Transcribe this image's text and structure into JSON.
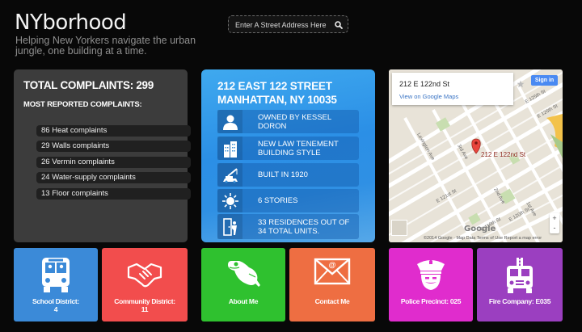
{
  "header": {
    "brand": "NYborhood",
    "tagline": "Helping New Yorkers navigate the urban jungle, one building at a time.",
    "search_placeholder": "Enter A Street Address Here"
  },
  "complaints": {
    "total_label": "TOTAL COMPLAINTS: 299",
    "most_label": "MOST REPORTED COMPLAINTS:",
    "items": [
      "86 Heat complaints",
      "29 Walls complaints",
      "26 Vermin complaints",
      "24 Water-supply complaints",
      "13 Floor complaints"
    ]
  },
  "building": {
    "address_line1": "212 EAST 122 STREET",
    "address_line2": "MANHATTAN, NY 10035",
    "rows": [
      {
        "icon": "person-icon",
        "text": "OWNED BY KESSEL DORON"
      },
      {
        "icon": "building-icon",
        "text": "NEW LAW TENEMENT BUILDING STYLE"
      },
      {
        "icon": "crane-icon",
        "text": "BUILT IN 1920"
      },
      {
        "icon": "floors-icon",
        "text": "6 STORIES"
      },
      {
        "icon": "door-icon",
        "text": "33 RESIDENCES OUT OF 34 TOTAL UNITS."
      }
    ]
  },
  "map": {
    "card_title": "212 E 122nd St",
    "card_link": "View on Google Maps",
    "sign_in": "Sign in",
    "marker_label": "212 E 122nd St",
    "zoom_in": "+",
    "zoom_out": "-",
    "google": "Google",
    "attribution": "©2014 Google · Map Data    Terms of Use    Report a map error",
    "streets": [
      "Lexington Ave",
      "3rd Ave",
      "2nd Ave",
      "1st Ave",
      "E 125th St",
      "E 126th St",
      "E 121st St",
      "E 119th St",
      "E 120th St"
    ]
  },
  "tiles": [
    {
      "name": "school-district",
      "label": "School District:\n4",
      "color": "#3b8ad8",
      "icon": "school-bus-icon"
    },
    {
      "name": "community-district",
      "label": "Community District:\n11",
      "color": "#f24d4d",
      "icon": "handshake-icon"
    },
    {
      "name": "about-me",
      "label": "About Me",
      "color": "#2fc12f",
      "icon": "frog-icon"
    },
    {
      "name": "contact-me",
      "label": "Contact Me",
      "color": "#ee6e42",
      "icon": "envelope-icon"
    },
    {
      "name": "police-precinct",
      "label": "Police Precinct: 025",
      "color": "#e02ccd",
      "icon": "police-officer-icon"
    },
    {
      "name": "fire-company",
      "label": "Fire Company: E035",
      "color": "#9b3fc0",
      "icon": "fire-truck-icon"
    }
  ]
}
